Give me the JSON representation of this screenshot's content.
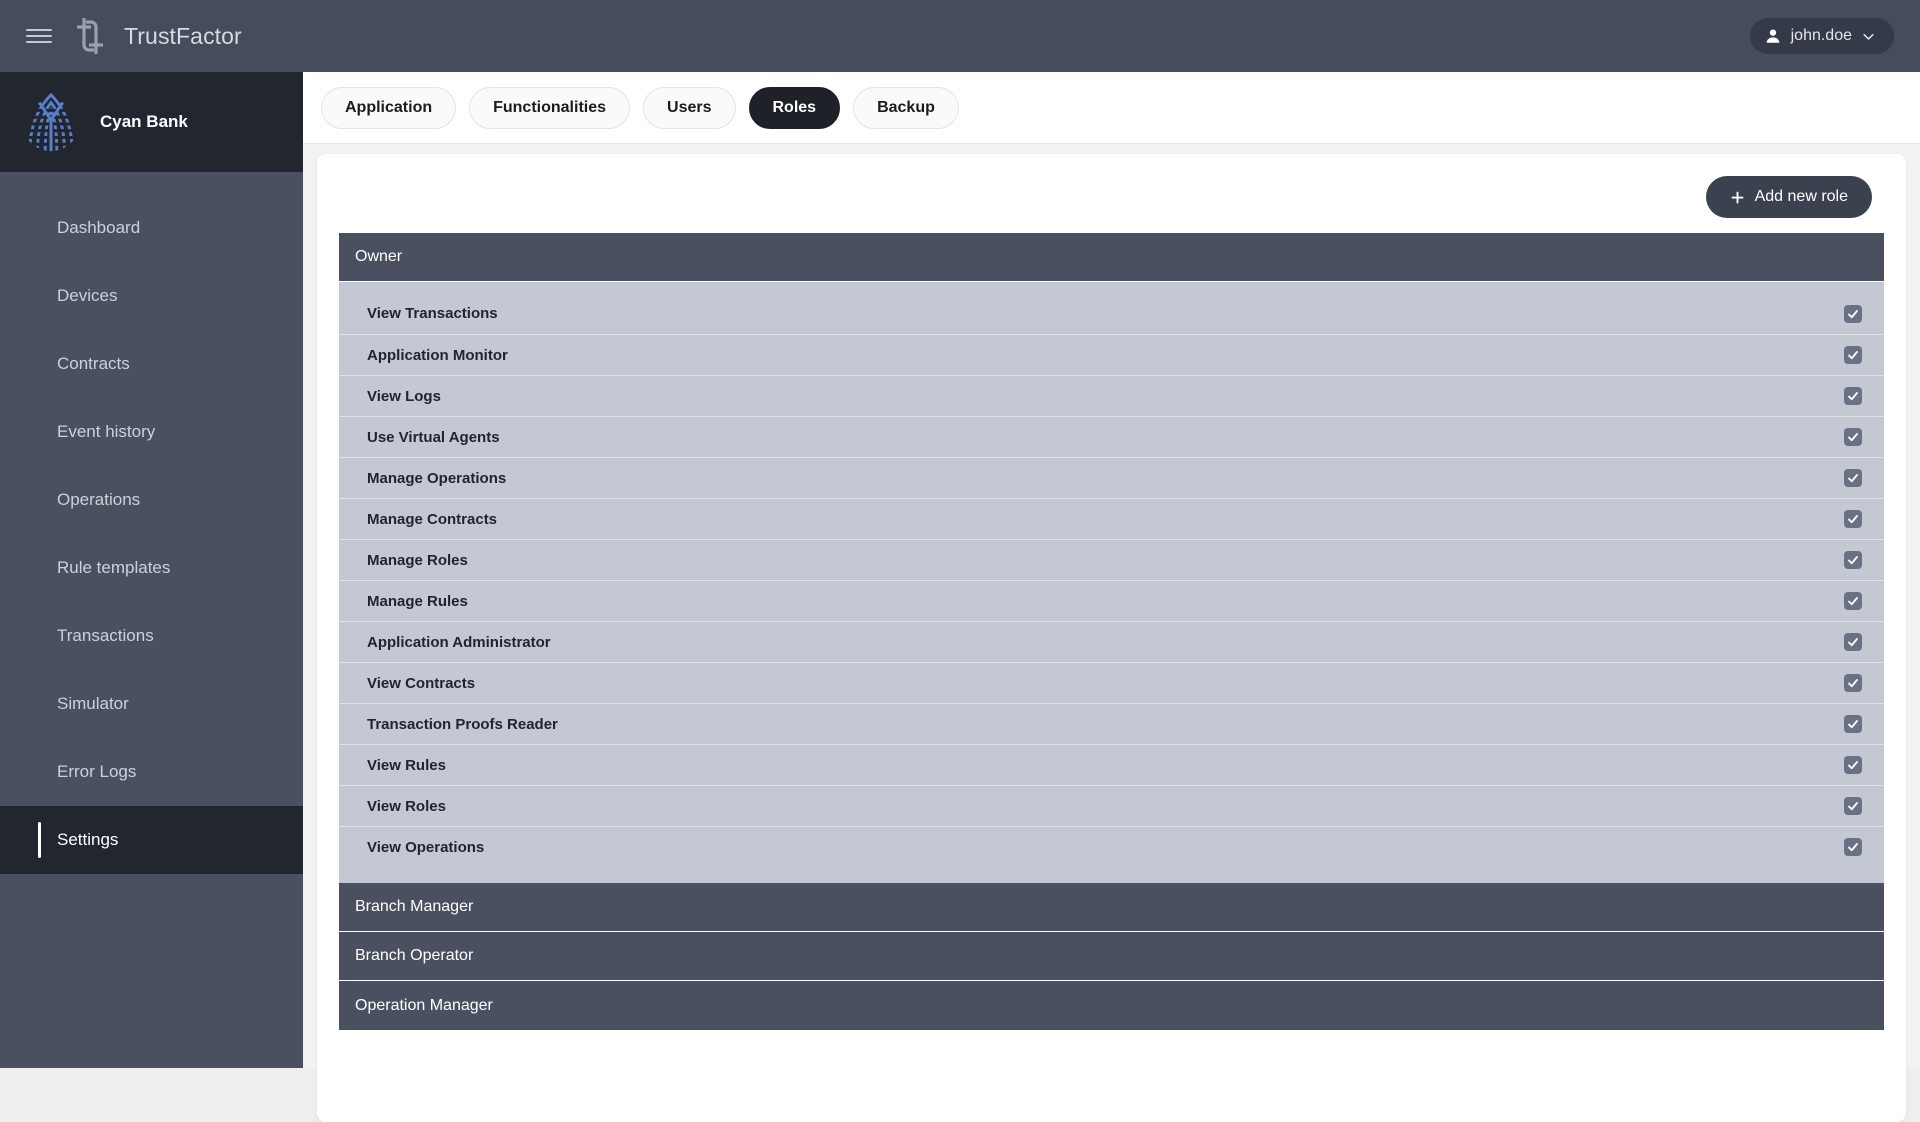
{
  "topbar": {
    "menu_icon": "hamburger-icon",
    "logo_icon": "trustfactor-logo-icon",
    "app_name": "TrustFactor",
    "user": {
      "avatar_icon": "user-avatar-icon",
      "name": "john.doe",
      "chevron_icon": "chevron-down-icon"
    }
  },
  "sidebar": {
    "org": {
      "logo_icon": "cyan-bank-logo-icon",
      "name": "Cyan Bank"
    },
    "items": [
      {
        "label": "Dashboard",
        "active": false
      },
      {
        "label": "Devices",
        "active": false
      },
      {
        "label": "Contracts",
        "active": false
      },
      {
        "label": "Event history",
        "active": false
      },
      {
        "label": "Operations",
        "active": false
      },
      {
        "label": "Rule templates",
        "active": false
      },
      {
        "label": "Transactions",
        "active": false
      },
      {
        "label": "Simulator",
        "active": false
      },
      {
        "label": "Error Logs",
        "active": false
      },
      {
        "label": "Settings",
        "active": true
      }
    ]
  },
  "tabs": [
    {
      "label": "Application",
      "active": false
    },
    {
      "label": "Functionalities",
      "active": false
    },
    {
      "label": "Users",
      "active": false
    },
    {
      "label": "Roles",
      "active": true
    },
    {
      "label": "Backup",
      "active": false
    }
  ],
  "toolbar": {
    "add_role_label": "Add new role",
    "add_role_icon": "plus-icon"
  },
  "roles": [
    {
      "name": "Owner",
      "expanded": true,
      "permissions": [
        {
          "label": "View Transactions",
          "checked": true
        },
        {
          "label": "Application Monitor",
          "checked": true
        },
        {
          "label": "View Logs",
          "checked": true
        },
        {
          "label": "Use Virtual Agents",
          "checked": true
        },
        {
          "label": "Manage Operations",
          "checked": true
        },
        {
          "label": "Manage Contracts",
          "checked": true
        },
        {
          "label": "Manage Roles",
          "checked": true
        },
        {
          "label": "Manage Rules",
          "checked": true
        },
        {
          "label": "Application Administrator",
          "checked": true
        },
        {
          "label": "View Contracts",
          "checked": true
        },
        {
          "label": "Transaction Proofs Reader",
          "checked": true
        },
        {
          "label": "View Rules",
          "checked": true
        },
        {
          "label": "View Roles",
          "checked": true
        },
        {
          "label": "View Operations",
          "checked": true
        }
      ]
    },
    {
      "name": "Branch Manager",
      "expanded": false,
      "permissions": []
    },
    {
      "name": "Branch Operator",
      "expanded": false,
      "permissions": []
    },
    {
      "name": "Operation Manager",
      "expanded": false,
      "permissions": []
    }
  ],
  "colors": {
    "topbar_bg": "#464c5c",
    "sidebar_bg": "#4a5060",
    "sidebar_active_bg": "#22262f",
    "accent_blue": "#5b7ec9",
    "role_header_bg": "#4a5060",
    "role_body_bg": "#c3c8d2",
    "tab_active_bg": "#1f2128",
    "checkbox_bg": "#6a7184"
  }
}
